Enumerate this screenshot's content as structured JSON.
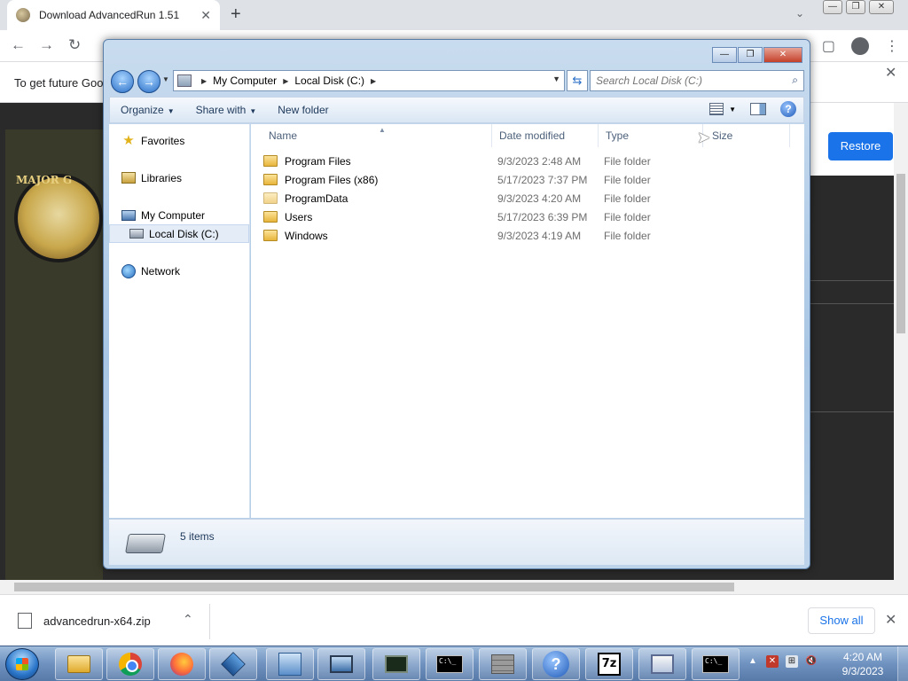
{
  "browser": {
    "tab_title": "Download AdvancedRun 1.51",
    "tab_close": "✕",
    "new_tab": "+",
    "tab_search": "⌄",
    "window_controls": [
      "—",
      "❐",
      "✕"
    ],
    "nav": {
      "back": "←",
      "forward": "→",
      "reload": "↻"
    },
    "infobar_text": "To get future Goo",
    "infobar_close": "✕",
    "restore_label": "Restore",
    "download": {
      "filename": "advancedrun-x64.zip",
      "chevron": "⌃",
      "show_all_label": "Show all",
      "close": "✕"
    }
  },
  "page": {
    "comic_text": "MAJOR G"
  },
  "explorer": {
    "caption_buttons": [
      "—",
      "❐",
      "✕"
    ],
    "breadcrumb": [
      "My Computer",
      "Local Disk (C:)"
    ],
    "search_placeholder": "Search Local Disk (C:)",
    "commands": [
      "Organize",
      "Share with",
      "New folder"
    ],
    "nav_pane": {
      "favorites": "Favorites",
      "libraries": "Libraries",
      "my_computer": "My Computer",
      "local_disk": "Local Disk (C:)",
      "network": "Network"
    },
    "columns": {
      "name": "Name",
      "date_modified": "Date modified",
      "type": "Type",
      "size": "Size"
    },
    "files": [
      {
        "name": "Program Files",
        "date": "9/3/2023 2:48 AM",
        "type": "File folder"
      },
      {
        "name": "Program Files (x86)",
        "date": "5/17/2023 7:37 PM",
        "type": "File folder"
      },
      {
        "name": "ProgramData",
        "date": "9/3/2023 4:20 AM",
        "type": "File folder"
      },
      {
        "name": "Users",
        "date": "5/17/2023 6:39 PM",
        "type": "File folder"
      },
      {
        "name": "Windows",
        "date": "9/3/2023 4:19 AM",
        "type": "File folder"
      }
    ],
    "status_text": "5 items"
  },
  "taskbar": {
    "apps": [
      "explorer",
      "chrome",
      "firefox",
      "virtualbox",
      "network-tool",
      "monitor",
      "terminal-green",
      "cmd",
      "firewall",
      "help",
      "7zip",
      "window-app",
      "cmd-2"
    ],
    "cmd_label": "C:\\_",
    "zip_label": "7z",
    "help_label": "?",
    "clock_time": "4:20 AM",
    "clock_date": "9/3/2023"
  }
}
